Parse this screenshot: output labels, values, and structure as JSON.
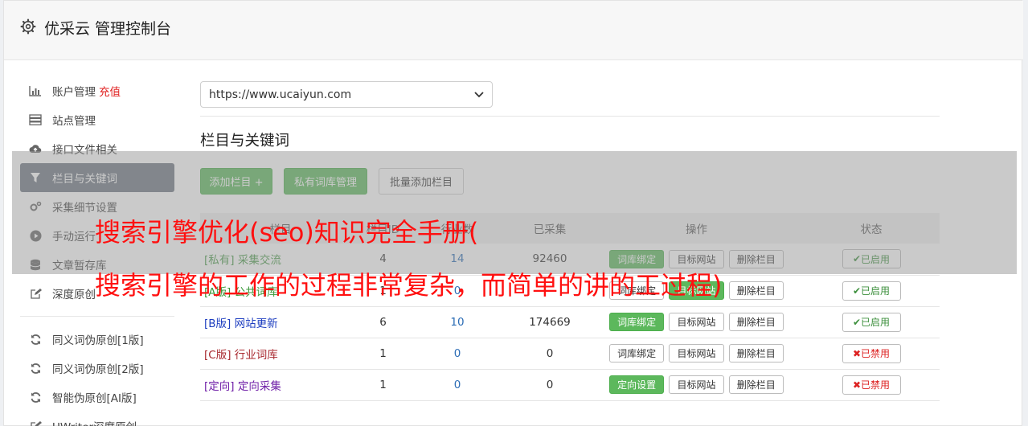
{
  "header": {
    "title": "优采云 管理控制台",
    "icon": "gear-icon"
  },
  "sidebar": {
    "items": [
      {
        "label": "账户管理",
        "badge": "充值",
        "icon": "bar-chart-icon"
      },
      {
        "label": "站点管理",
        "icon": "server-icon"
      },
      {
        "label": "接口文件相关",
        "icon": "cloud-upload-icon"
      },
      {
        "label": "栏目与关键词",
        "icon": "filter-icon",
        "active": true
      },
      {
        "label": "采集细节设置",
        "icon": "cogs-icon"
      },
      {
        "label": "手动运行",
        "icon": "play-icon"
      },
      {
        "label": "文章暂存库",
        "icon": "database-icon"
      },
      {
        "label": "深度原创",
        "icon": "edit-icon"
      }
    ],
    "items2": [
      {
        "label": "同义词伪原创[1版]",
        "icon": "refresh-icon"
      },
      {
        "label": "同义词伪原创[2版]",
        "icon": "refresh-icon"
      },
      {
        "label": "智能伪原创[AI版]",
        "icon": "refresh-icon"
      },
      {
        "label": "UWriter深度原创",
        "icon": "edit-icon"
      }
    ]
  },
  "main": {
    "site_select": "https://www.ucaiyun.com",
    "section_title": "栏目与关键词",
    "toolbar": {
      "add": "添加栏目 +",
      "private": "私有词库管理",
      "batch": "批量添加栏目"
    },
    "table": {
      "headers": [
        "栏目",
        "栏目ID",
        "行业数",
        "已采集",
        "操作",
        "状态"
      ],
      "rows": [
        {
          "tag": "[私有]",
          "name": "采集交流",
          "c1": "4",
          "c2": "14",
          "c3": "92460",
          "op1": "词库绑定",
          "op2": "目标网站",
          "op3": "删除栏目",
          "status": "已启用"
        },
        {
          "tag": "[A版]",
          "name": "公共词库",
          "c1": "1",
          "c2": "0",
          "c3": "",
          "op1": "词库绑定",
          "op2": "目标网站",
          "op3": "删除栏目",
          "status": "已启用"
        },
        {
          "tag": "[B版]",
          "name": "网站更新",
          "c1": "6",
          "c2": "10",
          "c3": "174669",
          "op1": "词库绑定",
          "op2": "目标网站",
          "op3": "删除栏目",
          "status": "已启用"
        },
        {
          "tag": "[C版]",
          "name": "行业词库",
          "c1": "1",
          "c2": "0",
          "c3": "0",
          "op1": "词库绑定",
          "op2": "目标网站",
          "op3": "删除栏目",
          "status": "已禁用"
        },
        {
          "tag": "[定向]",
          "name": "定向采集",
          "c1": "1",
          "c2": "0",
          "c3": "0",
          "op1": "定向设置",
          "op2": "目标网站",
          "op3": "删除栏目",
          "status": "已禁用"
        }
      ]
    }
  },
  "overlay": {
    "line1": "搜索引擎优化(seo)知识完全手册(",
    "line2": "搜索引擎的工作的过程非常复杂，而简单的讲的工过程)"
  },
  "colors": {
    "green": "#5cb85c",
    "active_nav": "#6e7783",
    "overlay_text": "#ff1010"
  }
}
